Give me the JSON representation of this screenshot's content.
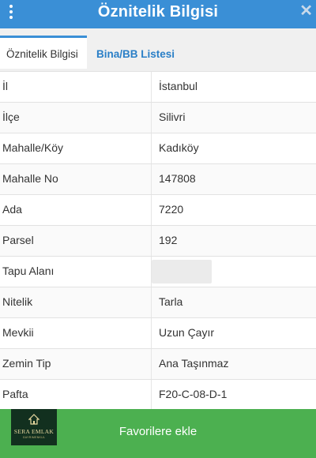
{
  "header": {
    "title": "Öznitelik Bilgisi",
    "close_symbol": "✕"
  },
  "tabs": [
    {
      "label": "Öznitelik Bilgisi",
      "active": true
    },
    {
      "label": "Bina/BB Listesi",
      "active": false
    }
  ],
  "rows": [
    {
      "label": "İl",
      "value": "İstanbul"
    },
    {
      "label": "İlçe",
      "value": "Silivri"
    },
    {
      "label": "Mahalle/Köy",
      "value": "Kadıköy"
    },
    {
      "label": "Mahalle No",
      "value": "147808"
    },
    {
      "label": "Ada",
      "value": "7220"
    },
    {
      "label": "Parsel",
      "value": "192"
    },
    {
      "label": "Tapu Alanı",
      "value": ""
    },
    {
      "label": "Nitelik",
      "value": "Tarla"
    },
    {
      "label": "Mevkii",
      "value": "Uzun Çayır"
    },
    {
      "label": "Zemin Tip",
      "value": "Ana Taşınmaz"
    },
    {
      "label": "Pafta",
      "value": "F20-C-08-D-1"
    }
  ],
  "footer": {
    "favorite_label": "Favorilere ekle"
  },
  "logo": {
    "brand": "SERA EMLAK",
    "sub": "GAYRIMENKUL"
  },
  "colors": {
    "header": "#3a8fd6",
    "footer": "#4cb050",
    "tab_active_text": "#2a7fc7"
  }
}
